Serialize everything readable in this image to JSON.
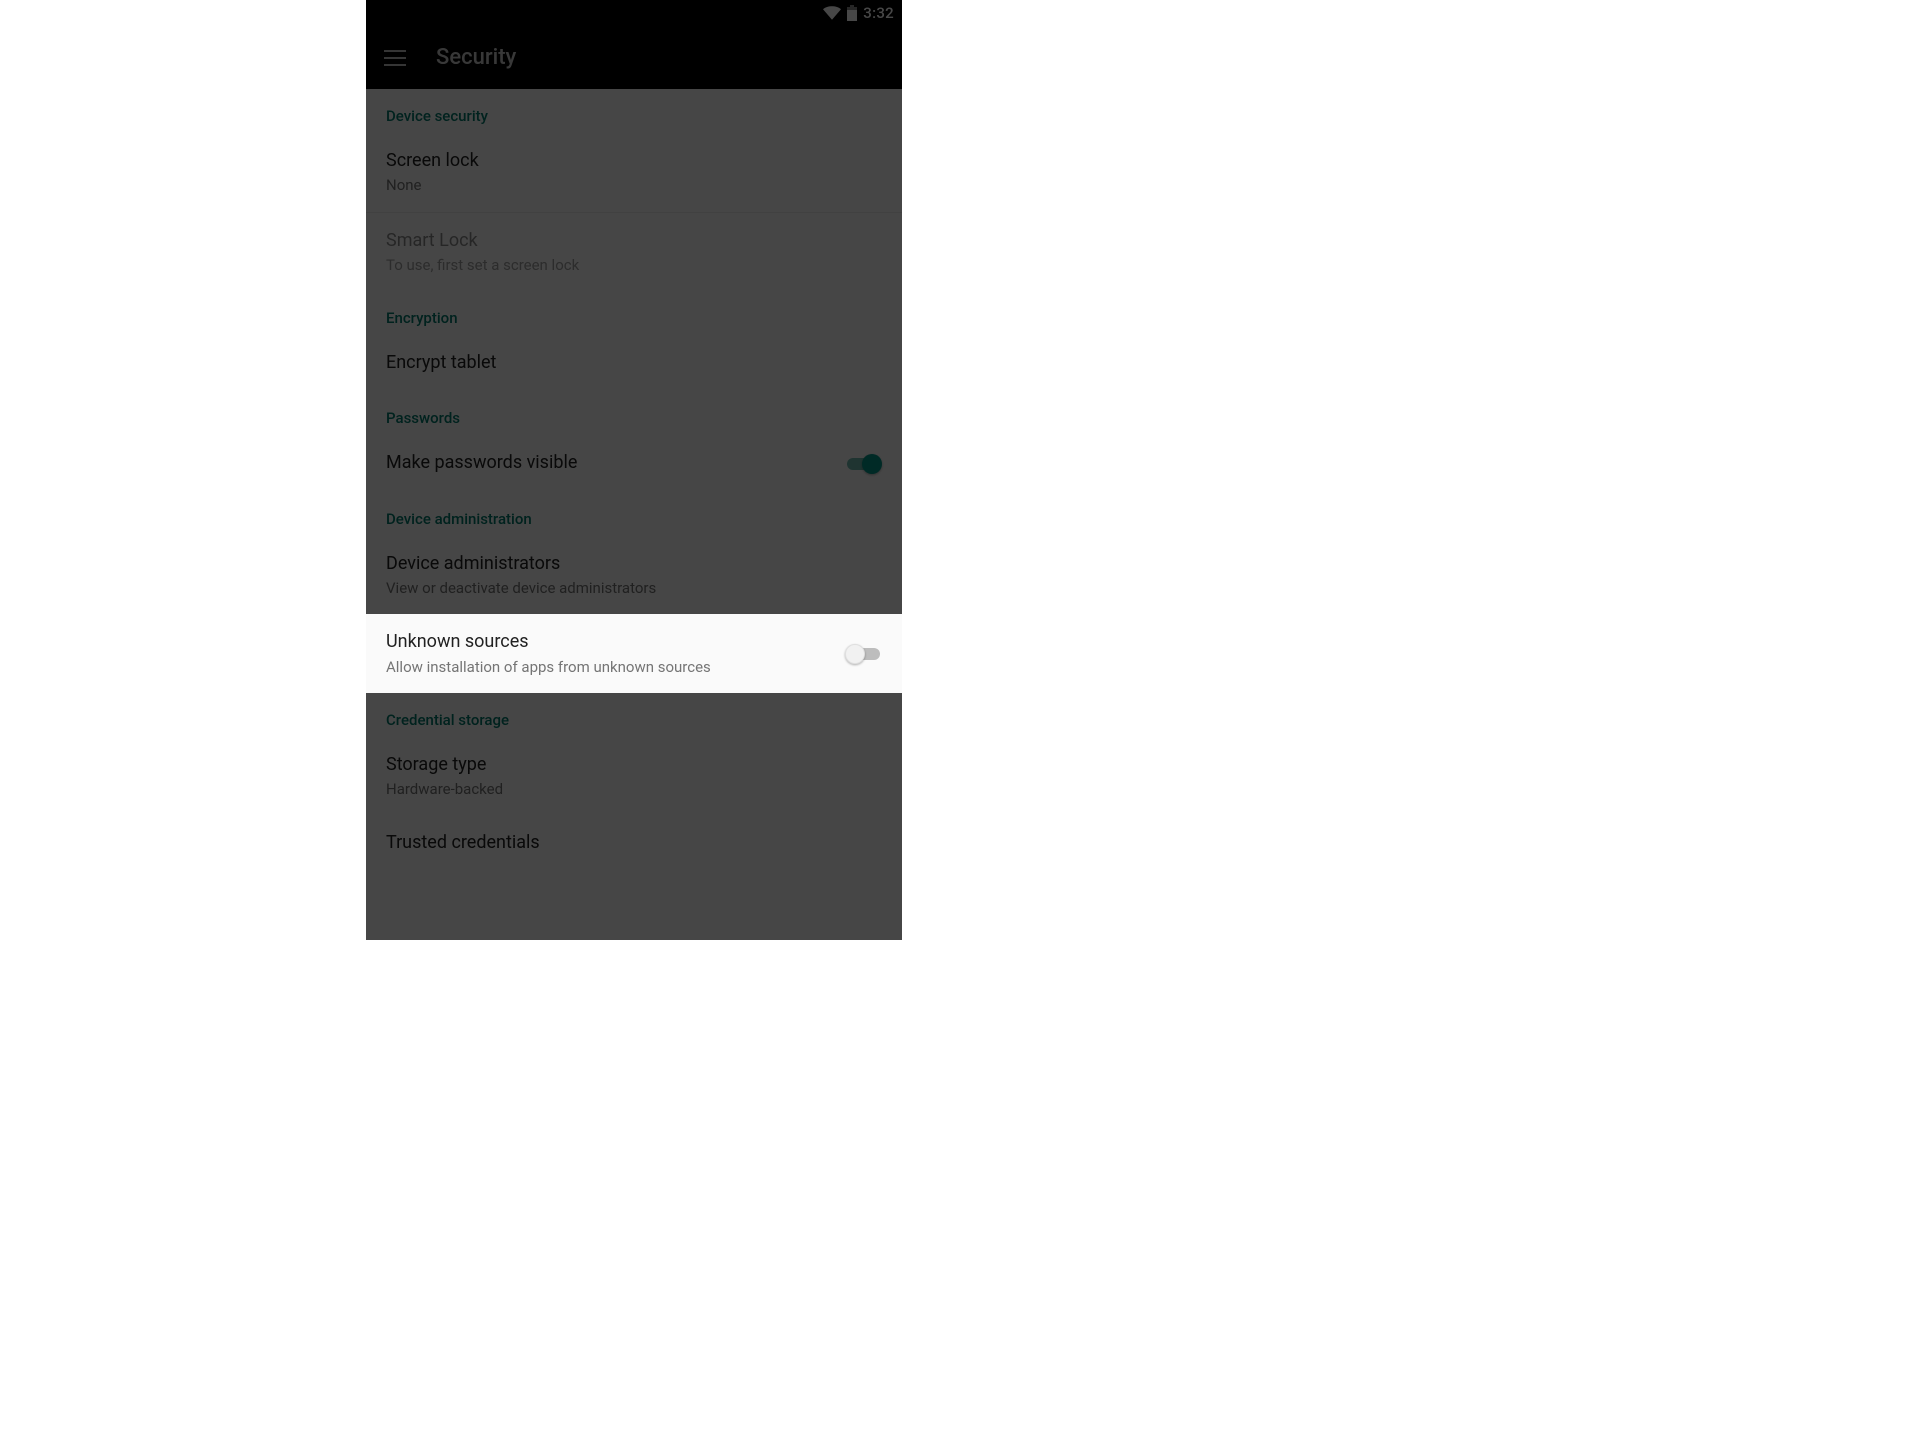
{
  "statusbar": {
    "time": "3:32"
  },
  "appbar": {
    "title": "Security"
  },
  "highlight_item_key": "unknown_sources",
  "sections": [
    {
      "header": "Device security",
      "items": [
        {
          "key": "screen_lock",
          "title": "Screen lock",
          "subtitle": "None",
          "divider": true
        },
        {
          "key": "smart_lock",
          "title": "Smart Lock",
          "subtitle": "To use, first set a screen lock",
          "disabled": true
        }
      ]
    },
    {
      "header": "Encryption",
      "items": [
        {
          "key": "encrypt_tablet",
          "title": "Encrypt tablet"
        }
      ]
    },
    {
      "header": "Passwords",
      "items": [
        {
          "key": "make_passwords_visible",
          "title": "Make passwords visible",
          "toggle": true,
          "toggle_on": true
        }
      ]
    },
    {
      "header": "Device administration",
      "items": [
        {
          "key": "device_admins",
          "title": "Device administrators",
          "subtitle": "View or deactivate device administrators"
        },
        {
          "key": "unknown_sources",
          "title": "Unknown sources",
          "subtitle": "Allow installation of apps from unknown sources",
          "toggle": true,
          "toggle_on": false
        }
      ]
    },
    {
      "header": "Credential storage",
      "items": [
        {
          "key": "storage_type",
          "title": "Storage type",
          "subtitle": "Hardware-backed"
        },
        {
          "key": "trusted_credentials",
          "title": "Trusted credentials"
        }
      ]
    }
  ]
}
